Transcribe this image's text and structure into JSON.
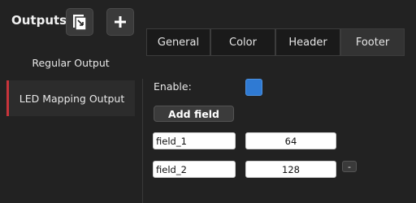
{
  "header": {
    "title": "Outputs",
    "duplicate_icon": "duplicate-output-icon",
    "add_icon": "plus-icon",
    "add_symbol": "+"
  },
  "sidebar": {
    "items": [
      {
        "label": "Regular Output",
        "selected": false
      },
      {
        "label": "LED Mapping Output",
        "selected": true
      }
    ]
  },
  "tabs": [
    {
      "label": "General",
      "active": false
    },
    {
      "label": "Color",
      "active": false
    },
    {
      "label": "Header",
      "active": false
    },
    {
      "label": "Footer",
      "active": true
    }
  ],
  "footer_panel": {
    "enable_label": "Enable:",
    "enable_checked": true,
    "add_field_label": "Add field",
    "fields": [
      {
        "name": "field_1",
        "value": "64",
        "removable": false
      },
      {
        "name": "field_2",
        "value": "128",
        "removable": true
      }
    ],
    "remove_symbol": "-"
  },
  "colors": {
    "background": "#222222",
    "accent_blue": "#2f7ad3",
    "selection_red": "#c8343b"
  }
}
